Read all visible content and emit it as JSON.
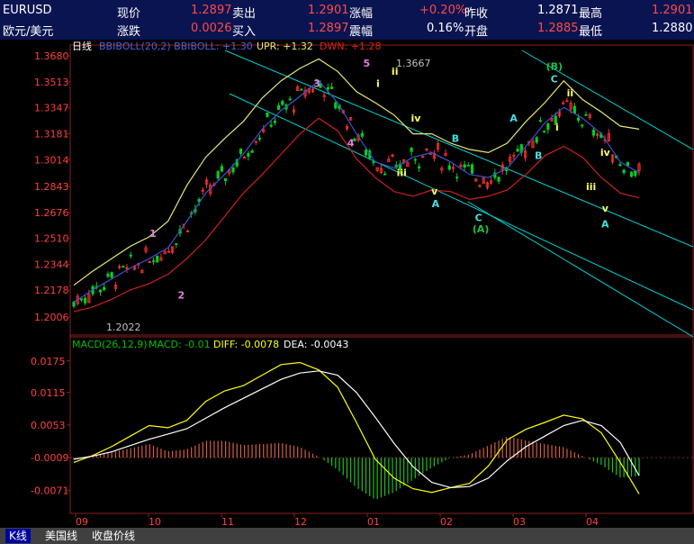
{
  "header": {
    "symbol": "EURUSD",
    "name": "欧元/美元",
    "row1": [
      {
        "label": "现价",
        "value": "1.2897"
      },
      {
        "label": "卖出",
        "value": "1.2901"
      },
      {
        "label": "涨幅",
        "value": "+0.20%"
      },
      {
        "label": "昨收",
        "value": "1.2871"
      },
      {
        "label": "最高",
        "value": "1.2901"
      }
    ],
    "row2": [
      {
        "label": "涨跌",
        "value": "0.0026"
      },
      {
        "label": "买入",
        "value": "1.2897"
      },
      {
        "label": "震幅",
        "value": "0.16%"
      },
      {
        "label": "开盘",
        "value": "1.2885"
      },
      {
        "label": "最低",
        "value": "1.2880"
      }
    ]
  },
  "main_panel": {
    "period_label": "日线",
    "indicator_label": "BBIBOLL(20,2) BBIBOLL: +1.30",
    "upr_label": "UPR: +1.32",
    "dwn_label": "DWN: +1.28",
    "low_annotation": "1.2022",
    "high_annotation": "1.3667",
    "colors": {
      "upper": "#e8e870",
      "mid": "#4050d0",
      "lower": "#d02020",
      "channel": "#00d0d0",
      "grid": "#8b2020"
    }
  },
  "macd_panel": {
    "title": "MACD(26,12,9)",
    "macd_label": "MACD: -0.01",
    "diff_label": "DIFF: -0.0078",
    "dea_label": "DEA: -0.0043"
  },
  "chart_data": [
    {
      "type": "candlestick",
      "title": "EURUSD 日线",
      "yticks": [
        "1.3680",
        "1.3513",
        "1.3347",
        "1.3181",
        "1.3014",
        "1.2843",
        "1.2676",
        "1.2510",
        "1.2344",
        "1.2178",
        "1.2006"
      ],
      "ylim": [
        1.2006,
        1.368
      ],
      "xticks": [
        "09",
        "10",
        "11",
        "12",
        "01",
        "02",
        "03",
        "04"
      ],
      "series": [
        {
          "name": "BBIBOLL",
          "values": [
            1.21,
            1.218,
            1.225,
            1.232,
            1.238,
            1.245,
            1.262,
            1.28,
            1.292,
            1.305,
            1.321,
            1.333,
            1.342,
            1.352,
            1.338,
            1.318,
            1.3,
            1.296,
            1.303,
            1.306,
            1.3,
            1.292,
            1.29,
            1.296,
            1.31,
            1.325,
            1.335,
            1.328,
            1.318,
            1.3,
            1.293
          ]
        },
        {
          "name": "UPR",
          "values": [
            1.221,
            1.23,
            1.238,
            1.246,
            1.252,
            1.262,
            1.285,
            1.303,
            1.315,
            1.326,
            1.341,
            1.352,
            1.36,
            1.366,
            1.358,
            1.345,
            1.338,
            1.33,
            1.318,
            1.318,
            1.312,
            1.308,
            1.306,
            1.312,
            1.326,
            1.338,
            1.352,
            1.34,
            1.332,
            1.323,
            1.321
          ]
        },
        {
          "name": "DWN",
          "values": [
            1.204,
            1.207,
            1.212,
            1.218,
            1.222,
            1.228,
            1.238,
            1.25,
            1.265,
            1.28,
            1.292,
            1.305,
            1.318,
            1.328,
            1.32,
            1.302,
            1.29,
            1.281,
            1.278,
            1.282,
            1.281,
            1.276,
            1.278,
            1.282,
            1.292,
            1.304,
            1.31,
            1.303,
            1.29,
            1.28,
            1.277
          ]
        }
      ],
      "wave_labels": [
        {
          "text": "1",
          "x": 0.14,
          "y": 1.252
        },
        {
          "text": "2",
          "x": 0.19,
          "y": 1.2125
        },
        {
          "text": "3",
          "x": 0.43,
          "y": 1.348
        },
        {
          "text": "4",
          "x": 0.49,
          "y": 1.31
        },
        {
          "text": "5",
          "x": 0.518,
          "y": 1.361
        },
        {
          "text": "i",
          "x": 0.538,
          "y": 1.348
        },
        {
          "text": "ii",
          "x": 0.568,
          "y": 1.356
        },
        {
          "text": "iii",
          "x": 0.58,
          "y": 1.291
        },
        {
          "text": "iv",
          "x": 0.605,
          "y": 1.326
        },
        {
          "text": "v",
          "x": 0.638,
          "y": 1.279
        },
        {
          "text": "A",
          "x": 0.64,
          "y": 1.271
        },
        {
          "text": "B",
          "x": 0.675,
          "y": 1.313
        },
        {
          "text": "C",
          "x": 0.716,
          "y": 1.262
        },
        {
          "text": "(A)",
          "x": 0.72,
          "y": 1.255
        },
        {
          "text": "A",
          "x": 0.778,
          "y": 1.326
        },
        {
          "text": "B",
          "x": 0.822,
          "y": 1.302
        },
        {
          "text": "(B)",
          "x": 0.85,
          "y": 1.359
        },
        {
          "text": "C",
          "x": 0.85,
          "y": 1.351
        },
        {
          "text": "ii",
          "x": 0.878,
          "y": 1.342
        },
        {
          "text": "i",
          "x": 0.855,
          "y": 1.32
        },
        {
          "text": "iv",
          "x": 0.94,
          "y": 1.304
        },
        {
          "text": "iii",
          "x": 0.915,
          "y": 1.282
        },
        {
          "text": "v",
          "x": 0.94,
          "y": 1.268
        },
        {
          "text": "A",
          "x": 0.94,
          "y": 1.258
        }
      ]
    },
    {
      "type": "bar",
      "title": "MACD(26,12,9)",
      "yticks": [
        "0.0175",
        "0.0115",
        "0.0053",
        "-0.0009",
        "-0.0071"
      ],
      "ylim": [
        -0.0115,
        0.019
      ],
      "series": [
        {
          "name": "DIFF",
          "values": [
            -0.0018,
            -0.0005,
            0.0012,
            0.0032,
            0.0052,
            0.0048,
            0.0062,
            0.0098,
            0.0118,
            0.0128,
            0.0148,
            0.0168,
            0.0172,
            0.0158,
            0.0125,
            0.0058,
            -0.0012,
            -0.0048,
            -0.0068,
            -0.0075,
            -0.0066,
            -0.0058,
            -0.0025,
            0.0025,
            0.0045,
            0.0058,
            0.0072,
            0.0065,
            0.0038,
            -0.0018,
            -0.0078
          ]
        },
        {
          "name": "DEA",
          "values": [
            -0.0012,
            -0.0006,
            0.0002,
            0.0014,
            0.0026,
            0.0036,
            0.0046,
            0.0066,
            0.0086,
            0.0104,
            0.0122,
            0.014,
            0.0152,
            0.0156,
            0.0148,
            0.0115,
            0.0068,
            0.0018,
            -0.0026,
            -0.0056,
            -0.0066,
            -0.0064,
            -0.0048,
            -0.0015,
            0.0012,
            0.0032,
            0.0052,
            0.0062,
            0.0052,
            0.002,
            -0.0043
          ]
        },
        {
          "name": "MACD",
          "values": [
            -0.0004,
            0.0002,
            0.001,
            0.0018,
            0.0026,
            0.0012,
            0.0016,
            0.0032,
            0.0032,
            0.0024,
            0.0026,
            0.0028,
            0.002,
            0.0002,
            -0.0023,
            -0.0057,
            -0.008,
            -0.0066,
            -0.0042,
            -0.0019,
            0.0,
            0.0006,
            0.0023,
            0.004,
            0.0033,
            0.0026,
            0.002,
            0.0003,
            -0.0014,
            -0.0038,
            -0.0035
          ]
        }
      ]
    }
  ],
  "footer": {
    "tabs": [
      "K线",
      "美国线",
      "收盘价线"
    ]
  }
}
